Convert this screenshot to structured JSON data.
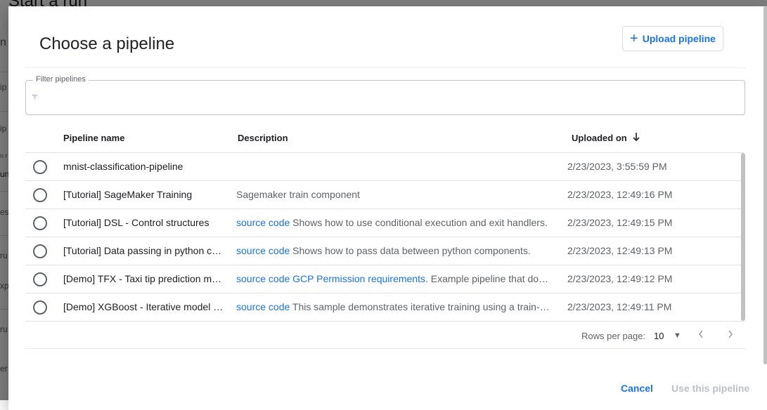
{
  "background": {
    "title": "Start a run",
    "fragments": [
      "n",
      "ip",
      "ip",
      "n r",
      "un",
      "es",
      "ru",
      "xp",
      "ru",
      "er"
    ]
  },
  "dialog": {
    "title": "Choose a pipeline",
    "upload_label": "Upload pipeline",
    "filter": {
      "label": "Filter pipelines",
      "value": ""
    },
    "columns": {
      "name": "Pipeline name",
      "description": "Description",
      "uploaded": "Uploaded on"
    },
    "rows": [
      {
        "name": "mnist-classification-pipeline",
        "link1": "",
        "link2": "",
        "description": "",
        "uploaded": "2/23/2023, 3:55:59 PM"
      },
      {
        "name": "[Tutorial] SageMaker Training",
        "link1": "",
        "link2": "",
        "description": "Sagemaker train component",
        "uploaded": "2/23/2023, 12:49:16 PM"
      },
      {
        "name": "[Tutorial] DSL - Control structures",
        "link1": "source code",
        "link2": "",
        "description": " Shows how to use conditional execution and exit handlers.",
        "uploaded": "2/23/2023, 12:49:15 PM"
      },
      {
        "name": "[Tutorial] Data passing in python components",
        "link1": "source code",
        "link2": "",
        "description": " Shows how to pass data between python components.",
        "uploaded": "2/23/2023, 12:49:13 PM"
      },
      {
        "name": "[Demo] TFX - Taxi tip prediction model trainer",
        "link1": "source code",
        "link2": " GCP Permission requirements",
        "description": ". Example pipeline that does classification with model analysis.",
        "uploaded": "2/23/2023, 12:49:12 PM"
      },
      {
        "name": "[Demo] XGBoost - Iterative model training",
        "link1": "source code",
        "link2": "",
        "description": " This sample demonstrates iterative training using a train-eval-check recursive loop.",
        "uploaded": "2/23/2023, 12:49:11 PM"
      }
    ],
    "pagination": {
      "label": "Rows per page:",
      "value": "10"
    },
    "cancel_label": "Cancel",
    "use_label": "Use this pipeline"
  },
  "colors": {
    "accent": "#1a73e8",
    "disabled": "#bdc1c6",
    "scrim": "rgba(0,0,0,0.5)"
  },
  "icons": {
    "upload": "plus-icon",
    "sort": "arrow-down-icon",
    "filter": "filter-icon",
    "dropdown": "caret-down-icon",
    "prev": "chevron-left-icon",
    "next": "chevron-right-icon"
  }
}
